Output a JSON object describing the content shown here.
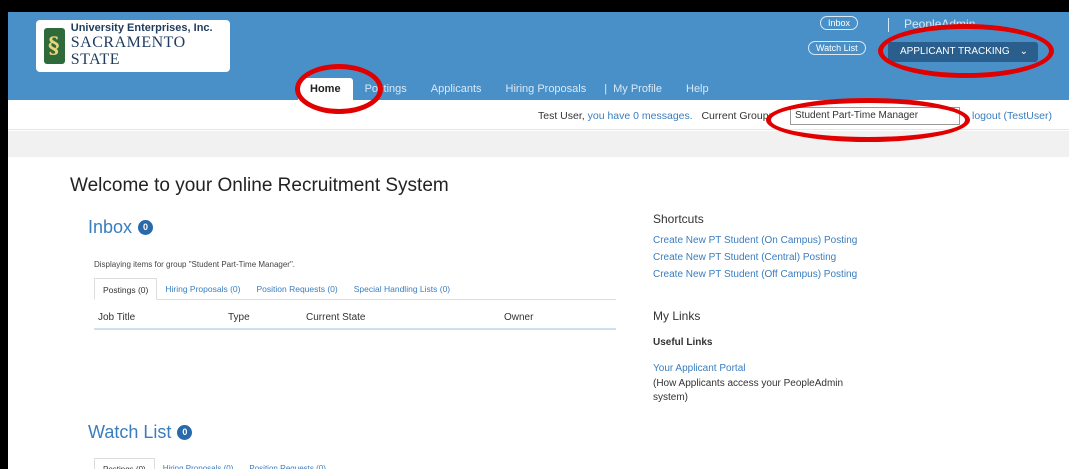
{
  "header": {
    "logo": {
      "line1": "University Enterprises, Inc.",
      "line2": "SACRAMENTO STATE"
    },
    "inbox_pill": "Inbox",
    "watchlist_pill": "Watch List",
    "user_name": "PeopleAdmin",
    "module_button": "APPLICANT TRACKING",
    "module_chevron": "⌄"
  },
  "nav": {
    "items": [
      "Home",
      "Postings",
      "Applicants",
      "Hiring Proposals",
      "My Profile",
      "Help"
    ],
    "separator": "|"
  },
  "subbar": {
    "user_text": "Test User,",
    "messages_link": "you have 0 messages.",
    "group_label": "Current Group:",
    "group_value": "Student Part-Time Manager",
    "logout": "logout (TestUser)"
  },
  "main": {
    "welcome": "Welcome to your Online Recruitment System",
    "inbox": {
      "title": "Inbox",
      "count": "0",
      "description": "Displaying items for group \"Student Part-Time Manager\".",
      "tabs": [
        "Postings (0)",
        "Hiring Proposals (0)",
        "Position Requests (0)",
        "Special Handling Lists (0)"
      ],
      "columns": [
        "Job Title",
        "Type",
        "Current State",
        "Owner"
      ]
    },
    "watchlist": {
      "title": "Watch List",
      "count": "0",
      "tabs": [
        "Postings (0)",
        "Hiring Proposals (0)",
        "Position Requests (0)"
      ]
    }
  },
  "sidebar": {
    "shortcuts_title": "Shortcuts",
    "shortcuts": [
      "Create New PT Student (On Campus) Posting",
      "Create New PT Student (Central) Posting",
      "Create New PT Student (Off Campus) Posting"
    ],
    "mylinks_title": "My Links",
    "useful_links_title": "Useful Links",
    "applicant_portal": "Your Applicant Portal",
    "applicant_portal_note": "(How Applicants access your PeopleAdmin system)"
  },
  "colors": {
    "header_blue": "#4a90c8",
    "link_blue": "#3a7dbf",
    "badge_blue": "#2a6aaa",
    "highlight_red": "#e00000"
  }
}
